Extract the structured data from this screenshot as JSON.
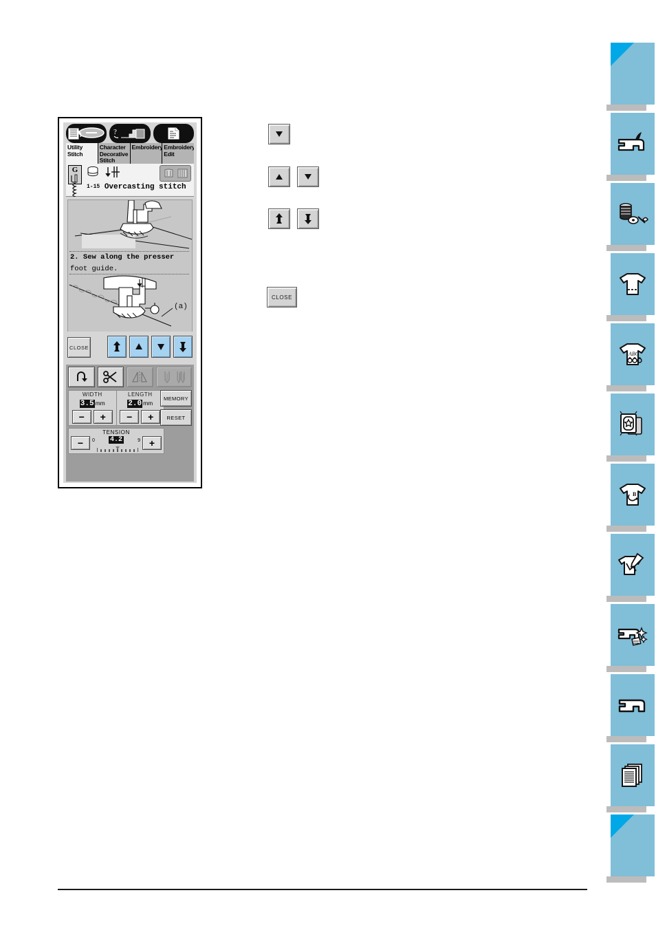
{
  "lcd": {
    "icon_bar": [
      {
        "name": "stitch-guide-icon",
        "label": "stitch guide"
      },
      {
        "name": "machine-help-icon",
        "label": "machine help"
      },
      {
        "name": "settings-list-icon",
        "label": "settings"
      }
    ],
    "tabs": [
      {
        "id": "utility-stitch",
        "label": "Utility Stitch",
        "active": true
      },
      {
        "id": "character-decorative-stitch",
        "label": "Character Decorative Stitch",
        "active": false
      },
      {
        "id": "embroidery",
        "label": "Embroidery",
        "active": false
      },
      {
        "id": "embroidery-edit",
        "label": "Embroidery Edit",
        "active": false
      }
    ],
    "stitch": {
      "presser_foot": "G",
      "number": "1-15",
      "name": "Overcasting stitch"
    },
    "help": {
      "step_line1": "2. Sew along the presser",
      "step_line2": "foot guide.",
      "callout": "(a)"
    },
    "close_label": "CLOSE",
    "nav_buttons": [
      {
        "name": "nav-first-button",
        "glyph": "first"
      },
      {
        "name": "nav-up-button",
        "glyph": "up"
      },
      {
        "name": "nav-down-button",
        "glyph": "down"
      },
      {
        "name": "nav-last-button",
        "glyph": "last"
      }
    ]
  },
  "controls": {
    "function_buttons": [
      {
        "name": "reverse-stitch-button",
        "enabled": true
      },
      {
        "name": "thread-cutter-button",
        "enabled": true
      },
      {
        "name": "mirror-image-button",
        "enabled": false
      },
      {
        "name": "needle-mode-button",
        "enabled": false
      }
    ],
    "width": {
      "label": "WIDTH",
      "value": "3.5",
      "unit": "mm",
      "minus": "−",
      "plus": "+"
    },
    "length": {
      "label": "LENGTH",
      "value": "2.0",
      "unit": "mm",
      "minus": "−",
      "plus": "+"
    },
    "tension": {
      "label": "TENSION",
      "value": "4.2",
      "scale_min": "0",
      "scale_max": "9",
      "minus": "−",
      "plus": "+"
    },
    "memory_label": "MEMORY",
    "reset_label": "RESET"
  },
  "samples": {
    "row1": [
      {
        "name": "sample-down-arrow-button",
        "glyph": "down"
      }
    ],
    "row2": [
      {
        "name": "sample-up-arrow-button",
        "glyph": "up"
      },
      {
        "name": "sample-down-arrow-button",
        "glyph": "down"
      }
    ],
    "row3": [
      {
        "name": "sample-first-arrow-button",
        "glyph": "first"
      },
      {
        "name": "sample-last-arrow-button",
        "glyph": "last"
      }
    ],
    "close_label": "CLOSE"
  },
  "index_tabs": [
    {
      "name": "index-tab-cover",
      "icon": "corner-marker",
      "corner": true
    },
    {
      "name": "index-tab-machine-setup",
      "icon": "sewing-machine-icon",
      "corner": false
    },
    {
      "name": "index-tab-accessories",
      "icon": "thread-spool-icon",
      "corner": false
    },
    {
      "name": "index-tab-utility-stitch",
      "icon": "tshirt-stitch-icon",
      "corner": false
    },
    {
      "name": "index-tab-character-stitch",
      "icon": "tshirt-abc-icon",
      "corner": false
    },
    {
      "name": "index-tab-embroidery",
      "icon": "embroidery-hoop-icon",
      "corner": false
    },
    {
      "name": "index-tab-embroidery-edit",
      "icon": "tshirt-edit-icon",
      "corner": false
    },
    {
      "name": "index-tab-my-custom-design",
      "icon": "tshirt-pencil-icon",
      "corner": false
    },
    {
      "name": "index-tab-appendix-care",
      "icon": "machine-clean-icon",
      "corner": false
    },
    {
      "name": "index-tab-appendix-machine",
      "icon": "sewing-machine-icon",
      "corner": false
    },
    {
      "name": "index-tab-index",
      "icon": "documents-icon",
      "corner": false
    },
    {
      "name": "index-tab-back-cover",
      "icon": "corner-marker",
      "corner": true
    }
  ],
  "colors": {
    "tab_blue": "#81bed8",
    "tab_corner_blue": "#00a8e8",
    "nav_button_blue": "#a5d2f0",
    "lcd_gray": "#d6d6d6",
    "panel_gray": "#9d9d9d"
  }
}
